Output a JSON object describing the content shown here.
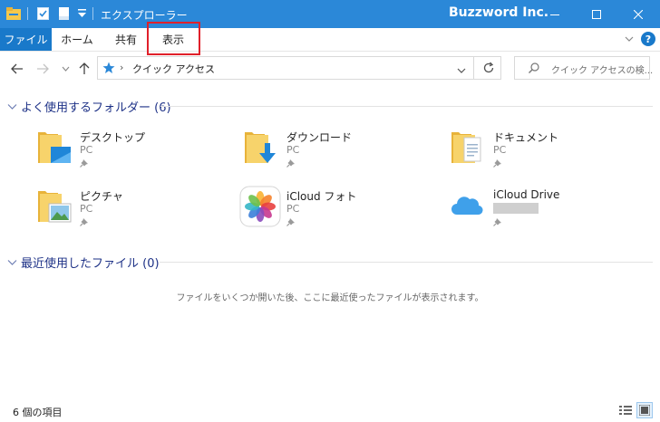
{
  "window": {
    "title": "エクスプローラー",
    "brand": "Buzzword Inc.",
    "controls": [
      "minimize",
      "maximize",
      "close"
    ]
  },
  "ribbon": {
    "tabs": [
      {
        "label": "ファイル"
      },
      {
        "label": "ホーム"
      },
      {
        "label": "共有"
      },
      {
        "label": "表示"
      }
    ]
  },
  "address": {
    "path": [
      "クイック アクセス"
    ]
  },
  "search": {
    "placeholder": "クイック アクセスの検..."
  },
  "folders": {
    "heading": "よく使用するフォルダー (6)",
    "items": [
      {
        "name": "デスクトップ",
        "location": "PC",
        "icon": "desktop-folder-icon"
      },
      {
        "name": "ダウンロード",
        "location": "PC",
        "icon": "downloads-folder-icon"
      },
      {
        "name": "ドキュメント",
        "location": "PC",
        "icon": "documents-folder-icon"
      },
      {
        "name": "ピクチャ",
        "location": "PC",
        "icon": "pictures-folder-icon"
      },
      {
        "name": "iCloud フォト",
        "location": "PC",
        "icon": "icloud-photos-icon"
      },
      {
        "name": "iCloud Drive",
        "location": "",
        "icon": "icloud-drive-icon"
      }
    ]
  },
  "recent": {
    "heading": "最近使用したファイル (0)",
    "empty_message": "ファイルをいくつか開いた後、ここに最近使ったファイルが表示されます。"
  },
  "status": {
    "count": "6 個の項目"
  },
  "colors": {
    "titlebar": "#2b88d8",
    "file_tab": "#1979ca",
    "highlight": "#e0202a",
    "section_heading": "#1e3287"
  }
}
